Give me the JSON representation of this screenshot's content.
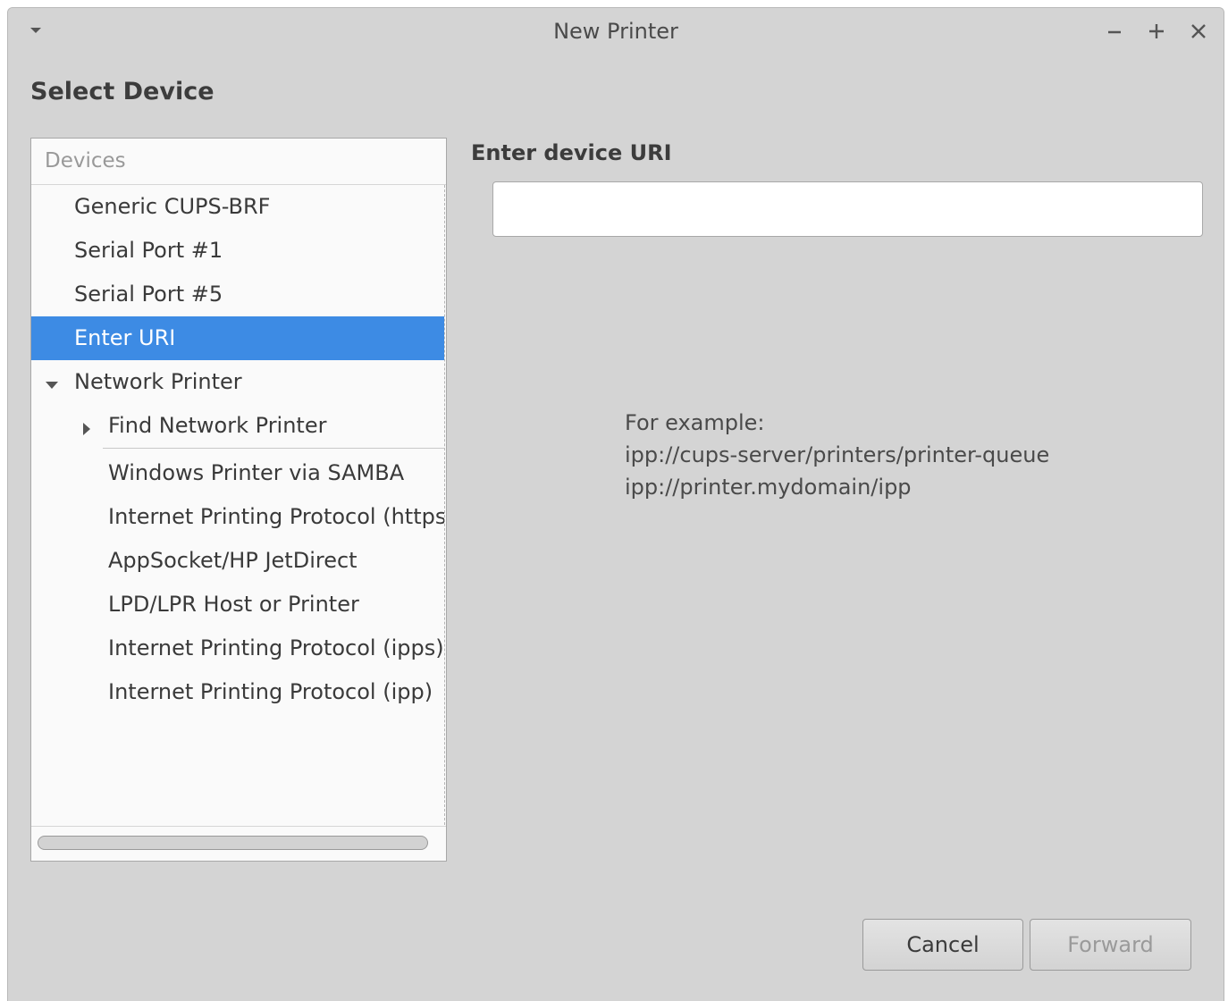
{
  "window": {
    "title": "New Printer"
  },
  "heading": "Select Device",
  "devices": {
    "header": "Devices",
    "items": [
      {
        "label": "Generic CUPS-BRF"
      },
      {
        "label": "Serial Port #1"
      },
      {
        "label": "Serial Port #5"
      },
      {
        "label": "Enter URI",
        "selected": true
      },
      {
        "label": "Network Printer",
        "expanded": true
      },
      {
        "label": "Find Network Printer",
        "expanded": false
      },
      {
        "label": "Windows Printer via SAMBA"
      },
      {
        "label": "Internet Printing Protocol (https)"
      },
      {
        "label": "AppSocket/HP JetDirect"
      },
      {
        "label": "LPD/LPR Host or Printer"
      },
      {
        "label": "Internet Printing Protocol (ipps)"
      },
      {
        "label": "Internet Printing Protocol (ipp)"
      }
    ]
  },
  "uri": {
    "label": "Enter device URI",
    "value": "",
    "example_title": "For example:",
    "example_1": "ipp://cups-server/printers/printer-queue",
    "example_2": "ipp://printer.mydomain/ipp"
  },
  "buttons": {
    "cancel": "Cancel",
    "forward": "Forward"
  },
  "colors": {
    "selection": "#3d8be4",
    "window_bg": "#d4d4d4"
  }
}
